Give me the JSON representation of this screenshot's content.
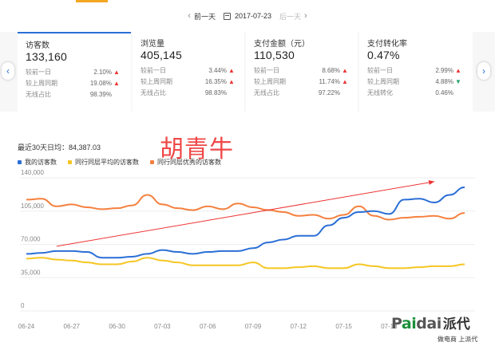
{
  "datenav": {
    "prev_label": "前一天",
    "date": "2017-07-23",
    "next_label": "后一天"
  },
  "metrics": [
    {
      "title": "访客数",
      "value": "133,160",
      "rows": [
        {
          "label": "较前一日",
          "value": "2.10%",
          "trend": "up"
        },
        {
          "label": "较上周同期",
          "value": "19.08%",
          "trend": "up"
        },
        {
          "label": "无线占比",
          "value": "98.39%",
          "trend": ""
        }
      ]
    },
    {
      "title": "浏览量",
      "value": "405,145",
      "rows": [
        {
          "label": "较前一日",
          "value": "3.44%",
          "trend": "up"
        },
        {
          "label": "较上周同期",
          "value": "16.35%",
          "trend": "up"
        },
        {
          "label": "无线占比",
          "value": "98.83%",
          "trend": ""
        }
      ]
    },
    {
      "title": "支付金额（元）",
      "value": "110,530",
      "rows": [
        {
          "label": "较前一日",
          "value": "8.68%",
          "trend": "up"
        },
        {
          "label": "较上周同期",
          "value": "11.74%",
          "trend": "up"
        },
        {
          "label": "无线占比",
          "value": "97.22%",
          "trend": ""
        }
      ]
    },
    {
      "title": "支付转化率",
      "value": "0.47%",
      "rows": [
        {
          "label": "较前一日",
          "value": "2.99%",
          "trend": "up"
        },
        {
          "label": "较上周同期",
          "value": "4.88%",
          "trend": "down"
        },
        {
          "label": "无线转化",
          "value": "0.46%",
          "trend": ""
        }
      ]
    }
  ],
  "icons": {
    "up": "▲",
    "down": "▼",
    "chev_left": "‹",
    "chev_right": "›"
  },
  "chart": {
    "avg_text": "最近30天日均：84,387.03",
    "annotation_text": "胡青牛",
    "legend": [
      {
        "name": "我的访客数",
        "color": "#2b6fd6"
      },
      {
        "name": "同行同层平均的访客数",
        "color": "#f5c623"
      },
      {
        "name": "同行同层优秀的访客数",
        "color": "#f5803e"
      }
    ]
  },
  "chart_data": {
    "type": "line",
    "ylim": [
      0,
      140000
    ],
    "yticks": [
      "0",
      "35,000",
      "70,000",
      "105,000",
      "140,000"
    ],
    "ytick_values": [
      0,
      35000,
      70000,
      105000,
      140000
    ],
    "x_tick_labels": [
      "06-24",
      "06-27",
      "06-30",
      "07-03",
      "07-06",
      "07-09",
      "07-12",
      "07-15",
      "07-18"
    ],
    "x_tick_indices": [
      0,
      3,
      6,
      9,
      12,
      15,
      18,
      21,
      24
    ],
    "num_points": 30,
    "series": [
      {
        "name": "我的访客数",
        "color": "#2b6fd6",
        "values": [
          60000,
          61000,
          63000,
          63000,
          62000,
          56000,
          56000,
          57000,
          60000,
          64000,
          62000,
          60000,
          62000,
          63000,
          63000,
          66000,
          72000,
          75000,
          79000,
          79000,
          90000,
          98000,
          104000,
          105000,
          102000,
          117000,
          118000,
          114000,
          122000,
          130000
        ]
      },
      {
        "name": "同行同层平均的访客数",
        "color": "#f5c623",
        "values": [
          55000,
          56000,
          54000,
          53000,
          51000,
          49000,
          49000,
          52000,
          56000,
          53000,
          51000,
          48000,
          48000,
          48000,
          48000,
          51000,
          45000,
          45000,
          46000,
          47000,
          45000,
          45000,
          49000,
          47000,
          45000,
          45000,
          46000,
          47000,
          47000,
          49000
        ]
      },
      {
        "name": "同行同层优秀的访客数",
        "color": "#f5803e",
        "values": [
          117000,
          118000,
          110000,
          112000,
          109000,
          107000,
          108000,
          111000,
          122000,
          112000,
          108000,
          106000,
          110000,
          107000,
          113000,
          109000,
          106000,
          104000,
          100000,
          101000,
          97000,
          101000,
          110000,
          100000,
          96000,
          98000,
          99000,
          100000,
          97000,
          103000
        ]
      }
    ],
    "trend_arrow": {
      "from": [
        2,
        68000
      ],
      "to": [
        27,
        136000
      ],
      "color": "#e33"
    }
  },
  "brand": {
    "word_pre": "P",
    "word_ai": "ai",
    "word_post": "dai",
    "cn": "派代",
    "slogan": "做电商 上派代"
  }
}
